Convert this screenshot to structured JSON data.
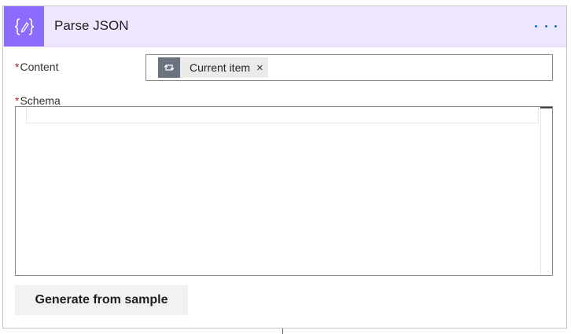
{
  "header": {
    "title": "Parse JSON",
    "icon": "curly-braces-icon",
    "accent_color": "#8c6cff",
    "background_color": "#efe6ff"
  },
  "content_field": {
    "required_marker": "*",
    "label": "Content",
    "token": {
      "icon": "loop-icon",
      "label": "Current item",
      "remove_glyph": "×"
    }
  },
  "schema_field": {
    "required_marker": "*",
    "label": "Schema",
    "value": ""
  },
  "actions": {
    "generate_label": "Generate from sample",
    "more_icon": "ellipsis-icon"
  }
}
